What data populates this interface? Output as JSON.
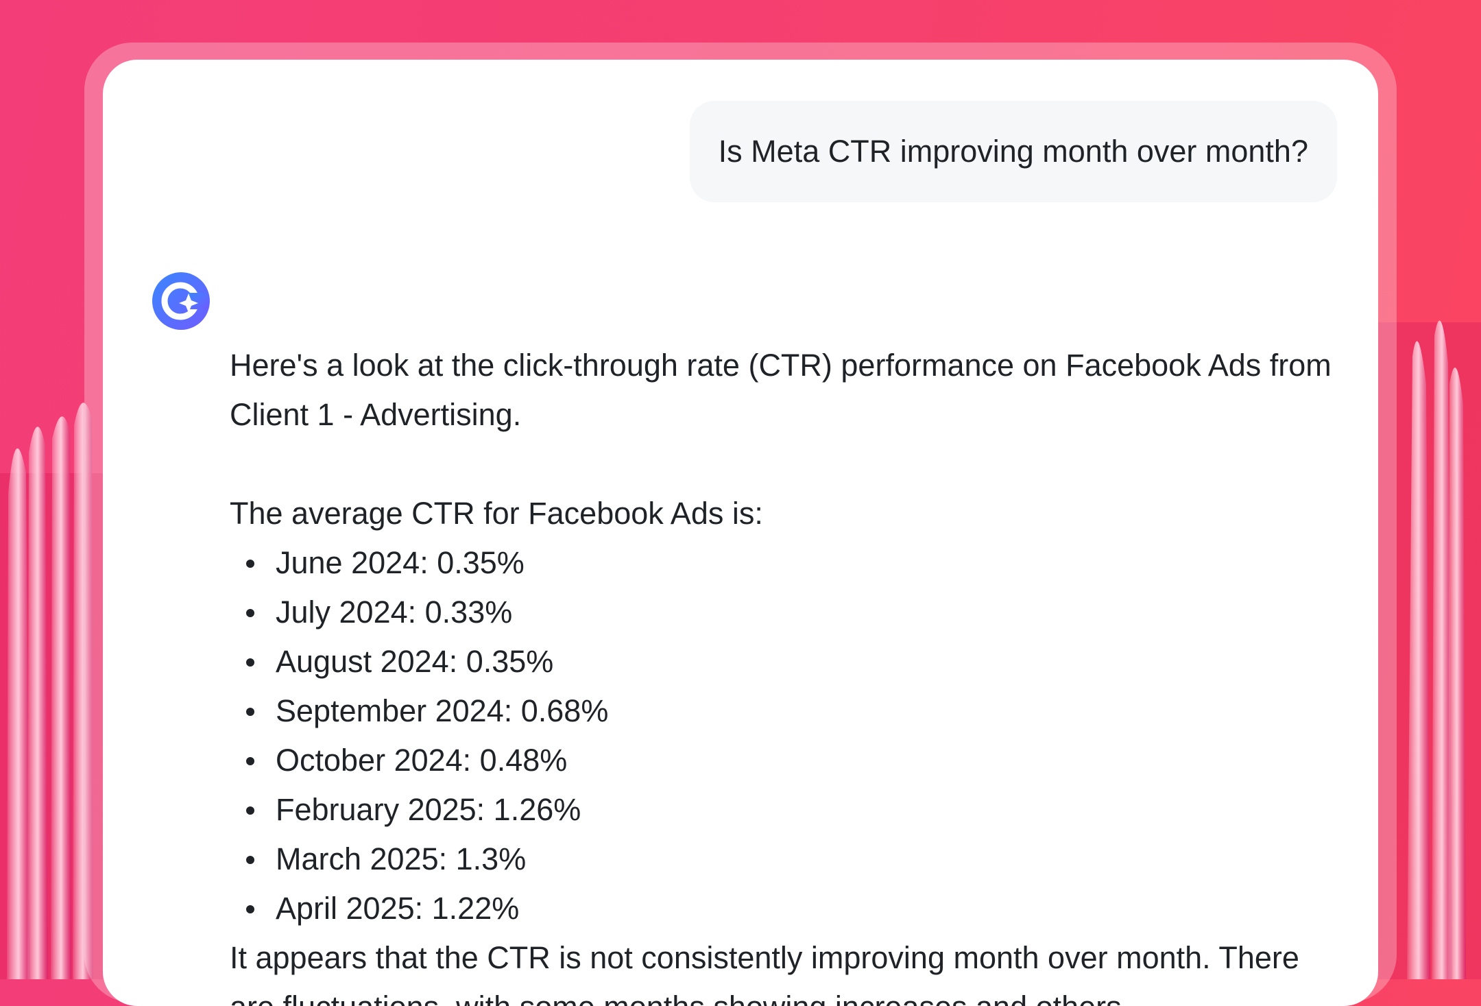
{
  "theme": {
    "background": "#f53f70",
    "card": "#ffffff",
    "user_bubble": "#f6f7f9",
    "text": "#1f2328",
    "avatar_gradient": [
      "#3a86ff",
      "#6f5cff"
    ]
  },
  "conversation": {
    "user_message": "Is Meta CTR improving month over month?",
    "assistant_avatar_icon": "sparkle-badge-icon",
    "assistant": {
      "intro": "Here's a look at the click-through rate (CTR) performance on Facebook Ads from Client 1 - Advertising.",
      "average_heading": "The average CTR for Facebook Ads is:",
      "ctr_items": [
        {
          "text": "June 2024: 0.35%"
        },
        {
          "text": "July 2024: 0.33%"
        },
        {
          "text": "August 2024: 0.35%"
        },
        {
          "text": "September 2024: 0.68%"
        },
        {
          "text": "October 2024: 0.48%"
        },
        {
          "text": "February 2025: 1.26%"
        },
        {
          "text": "March 2025: 1.3%"
        },
        {
          "text": "April 2025: 1.22%"
        }
      ],
      "conclusion": "It appears that the CTR is not consistently improving month over month. There are fluctuations, with some months showing increases and others"
    }
  }
}
